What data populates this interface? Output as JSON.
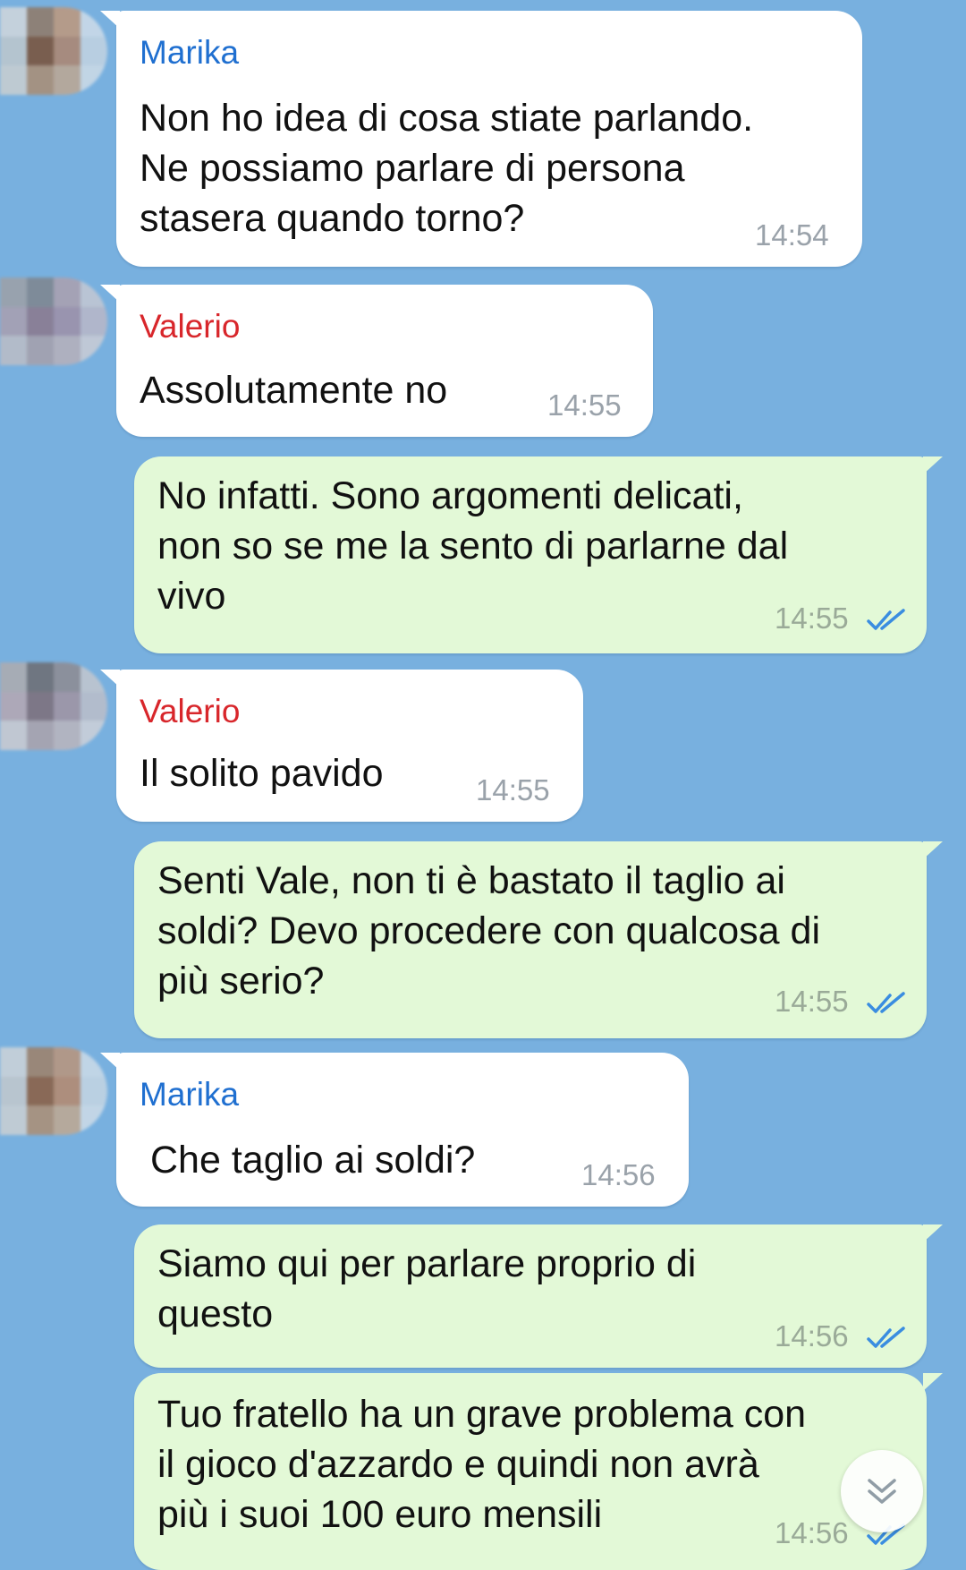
{
  "theme": {
    "background": "#78b0df",
    "incoming_bubble": "#ffffff",
    "outgoing_bubble": "#e3f9d7",
    "read_tick_color": "#3a8de0"
  },
  "messages": [
    {
      "direction": "incoming",
      "sender": "Marika",
      "sender_color": "#1f6fd0",
      "lines": [
        "Non ho idea di cosa stiate parlando.",
        "Ne possiamo parlare di persona",
        "stasera quando torno?"
      ],
      "time": "14:54"
    },
    {
      "direction": "incoming",
      "sender": "Valerio",
      "sender_color": "#d8262b",
      "lines": [
        "Assolutamente no"
      ],
      "time": "14:55"
    },
    {
      "direction": "outgoing",
      "lines": [
        "No infatti. Sono argomenti delicati,",
        "non so se me la sento di parlarne dal",
        "vivo"
      ],
      "time": "14:55",
      "status_icon": "double-check-icon"
    },
    {
      "direction": "incoming",
      "sender": "Valerio",
      "sender_color": "#d8262b",
      "lines": [
        "Il solito pavido"
      ],
      "time": "14:55"
    },
    {
      "direction": "outgoing",
      "lines": [
        "Senti Vale, non ti è bastato il taglio ai",
        "soldi? Devo procedere con qualcosa di",
        "più serio?"
      ],
      "time": "14:55",
      "status_icon": "double-check-icon"
    },
    {
      "direction": "incoming",
      "sender": "Marika",
      "sender_color": "#1f6fd0",
      "lines": [
        "Che taglio ai soldi?"
      ],
      "time": "14:56"
    },
    {
      "direction": "outgoing",
      "lines": [
        "Siamo qui per parlare proprio di",
        "questo"
      ],
      "time": "14:56",
      "status_icon": "double-check-icon"
    },
    {
      "direction": "outgoing",
      "lines": [
        "Tuo fratello ha un grave problema con",
        "il gioco d'azzardo e quindi non avrà",
        "più i suoi 100 euro mensili"
      ],
      "time": "14:56",
      "status_icon": "double-check-icon"
    }
  ],
  "scroll_down_button": {
    "icon": "double-chevron-down-icon"
  }
}
